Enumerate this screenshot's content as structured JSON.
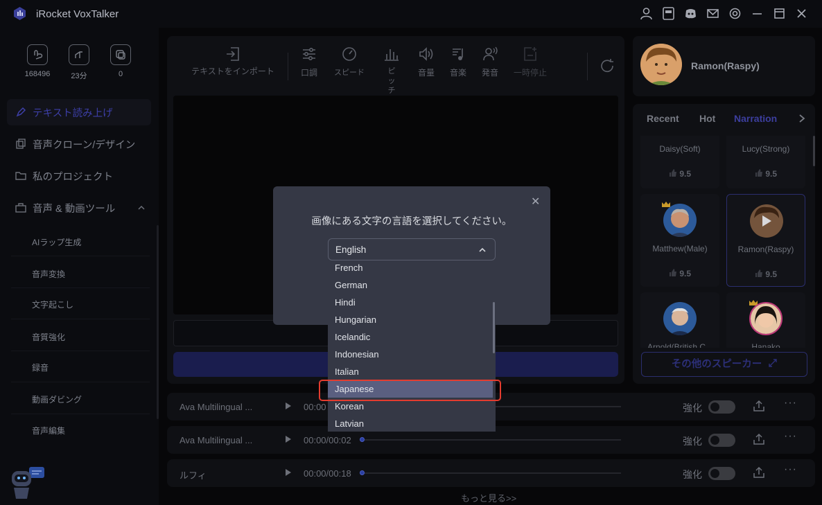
{
  "app": {
    "title": "iRocket VoxTalker"
  },
  "stats": [
    {
      "value": "168496"
    },
    {
      "value": "23分"
    },
    {
      "value": "0"
    }
  ],
  "nav": {
    "main": [
      {
        "label": "テキスト読み上げ",
        "active": true
      },
      {
        "label": "音声クローン/デザイン"
      },
      {
        "label": "私のプロジェクト"
      },
      {
        "label": "音声 & 動画ツール"
      }
    ],
    "sub": [
      "AIラップ生成",
      "音声変換",
      "文字起こし",
      "音質強化",
      "録音",
      "動画ダビング",
      "音声編集"
    ]
  },
  "toolbar": {
    "import": "テキストをインポート",
    "tone": "口調",
    "speed": "スピード",
    "pitch": "ピッチ",
    "volume": "音量",
    "music": "音楽",
    "pronounce": "発音",
    "pause": "一時停止"
  },
  "profile": {
    "name": "Ramon(Raspy)"
  },
  "tabs": [
    "Recent",
    "Hot",
    "Narration"
  ],
  "voices": [
    {
      "name": "Daisy(Soft)",
      "rating": "9.5"
    },
    {
      "name": "Lucy(Strong)",
      "rating": "9.5"
    },
    {
      "name": "Matthew(Male)",
      "rating": "9.5"
    },
    {
      "name": "Ramon(Raspy)",
      "rating": "9.5"
    },
    {
      "name": "Arnold(British C...",
      "rating": ""
    },
    {
      "name": "Hanako",
      "rating": ""
    }
  ],
  "more_speakers": "その他のスピーカー",
  "tracks": [
    {
      "name": "Ava Multilingual ...",
      "time": "00:00",
      "enhance": "強化"
    },
    {
      "name": "Ava Multilingual ...",
      "time": "00:00/00:02",
      "enhance": "強化"
    },
    {
      "name": "ルフィ",
      "time": "00:00/00:18",
      "enhance": "強化"
    }
  ],
  "see_more": "もっと見る>>",
  "dialog": {
    "prompt": "画像にある文字の言語を選択してください。",
    "selected": "English",
    "options": [
      "French",
      "German",
      "Hindi",
      "Hungarian",
      "Icelandic",
      "Indonesian",
      "Italian",
      "Japanese",
      "Korean",
      "Latvian"
    ],
    "highlighted": "Japanese"
  },
  "colors": {
    "accent": "#3d3fa8",
    "highlight": "#5a5f80",
    "annotation": "#e43c2f"
  }
}
